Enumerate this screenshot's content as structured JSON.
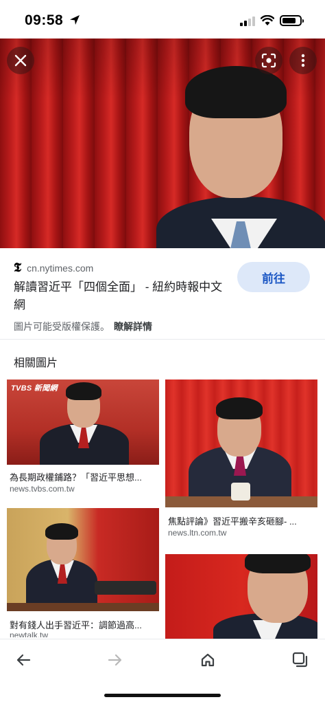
{
  "status_bar": {
    "time": "09:58"
  },
  "source": {
    "logo": "𝕿",
    "domain": "cn.nytimes.com",
    "title": "解讀習近平「四個全面」 - 紐約時報中文網",
    "visit_label": "前往",
    "copyright_notice": "圖片可能受版權保護。",
    "learn_more": "瞭解詳情"
  },
  "related": {
    "heading": "相關圖片",
    "cards": [
      {
        "title": "為長期政權鋪路？「習近平思想...",
        "source": "news.tvbs.com.tw",
        "logo": "TVBS 新聞網"
      },
      {
        "title": "焦點評論》習近平搬辛亥砸腳- ...",
        "source": "news.ltn.com.tw"
      },
      {
        "title": "對有錢人出手習近平：調節過高...",
        "source": "newtalk.tw"
      },
      {
        "title": "",
        "source": ""
      }
    ]
  },
  "icons": {
    "close": "close-icon",
    "lens": "google-lens-icon",
    "more": "more-vert-icon",
    "back": "arrow-back-icon",
    "forward": "arrow-forward-icon",
    "home": "home-icon",
    "tabs": "tabs-icon"
  },
  "colors": {
    "accent": "#1a56c4",
    "visit_bg": "#dde8f9",
    "curtain_red": "#b81b1b"
  }
}
